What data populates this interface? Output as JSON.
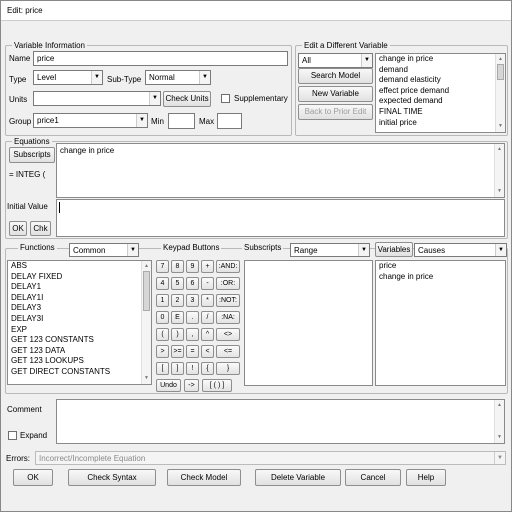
{
  "window": {
    "title": "Edit: price"
  },
  "variable_info": {
    "legend": "Variable Information",
    "name_label": "Name",
    "name_value": "price",
    "type_label": "Type",
    "type_value": "Level",
    "subtype_label": "Sub-Type",
    "subtype_value": "Normal",
    "units_label": "Units",
    "units_value": "",
    "check_units": "Check Units",
    "supplementary": "Supplementary",
    "group_label": "Group",
    "group_value": "price1",
    "min_label": "Min",
    "min_value": "",
    "max_label": "Max",
    "max_value": ""
  },
  "edit_different": {
    "legend": "Edit a Different Variable",
    "filter_value": "All",
    "search_model": "Search Model",
    "new_variable": "New Variable",
    "back_to_prior": "Back to Prior Edit",
    "variables": [
      "change in price",
      "demand",
      "demand elasticity",
      "effect price demand",
      "expected demand",
      "FINAL TIME",
      "initial price"
    ]
  },
  "equations": {
    "legend": "Equations",
    "subscripts_button": "Subscripts",
    "integ_label": "= INTEG  (",
    "equation_text": "change in price",
    "initial_value_label": "Initial Value",
    "initial_value": "",
    "ok": "OK",
    "chk": "Chk"
  },
  "functions": {
    "legend": "Functions",
    "category": "Common",
    "items": [
      "ABS",
      "DELAY FIXED",
      "DELAY1",
      "DELAY1I",
      "DELAY3",
      "DELAY3I",
      "EXP",
      "GET 123 CONSTANTS",
      "GET 123 DATA",
      "GET 123 LOOKUPS",
      "GET DIRECT CONSTANTS"
    ]
  },
  "keypad": {
    "legend": "Keypad Buttons",
    "rows": [
      [
        "7",
        "8",
        "9",
        "+",
        ":AND:"
      ],
      [
        "4",
        "5",
        "6",
        "-",
        ":OR:"
      ],
      [
        "1",
        "2",
        "3",
        "*",
        ":NOT:"
      ],
      [
        "0",
        "E",
        ".",
        "/",
        ":NA:"
      ],
      [
        "(",
        ")",
        ",",
        "^",
        "<>"
      ],
      [
        ">",
        ">=",
        "=",
        "<",
        "<="
      ],
      [
        "[",
        "]",
        "!",
        "{",
        "}"
      ]
    ],
    "last_row": [
      "Undo",
      "->",
      "[ ( ) ]"
    ]
  },
  "subscripts": {
    "legend": "Subscripts",
    "filter": "Range"
  },
  "variables_panel": {
    "button": "Variables",
    "filter": "Causes",
    "items": [
      "price",
      "change in price"
    ]
  },
  "comment": {
    "label": "Comment",
    "expand": "Expand",
    "value": ""
  },
  "errors": {
    "label": "Errors:",
    "value": "Incorrect/Incomplete Equation"
  },
  "bottom_buttons": {
    "ok": "OK",
    "check_syntax": "Check Syntax",
    "check_model": "Check Model",
    "delete_variable": "Delete Variable",
    "cancel": "Cancel",
    "help": "Help"
  }
}
